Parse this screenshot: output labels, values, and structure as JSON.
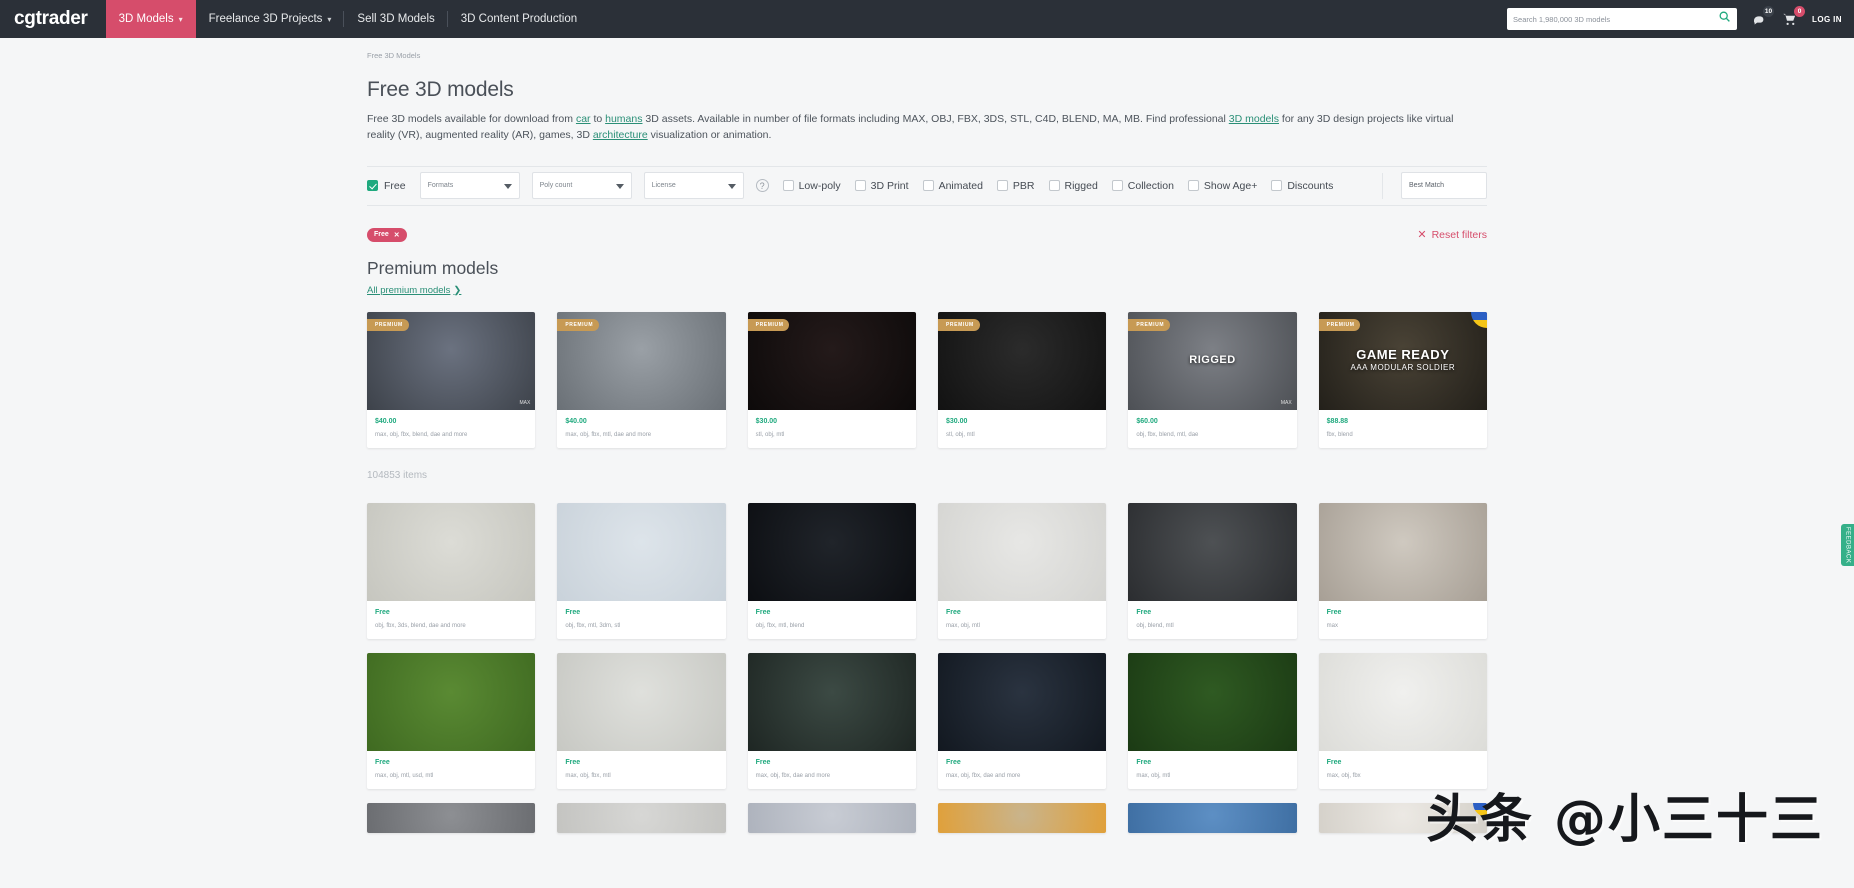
{
  "header": {
    "brand": "cgtrader",
    "nav": [
      {
        "label": "3D Models",
        "active": true,
        "caret": true
      },
      {
        "label": "Freelance 3D Projects",
        "active": false,
        "caret": true
      },
      {
        "label": "Sell 3D Models",
        "active": false,
        "caret": false
      },
      {
        "label": "3D Content Production",
        "active": false,
        "caret": false
      }
    ],
    "search_placeholder": "Search 1,980,000 3D models",
    "notifications_count": "10",
    "cart_count": "0",
    "login_label": "LOG IN"
  },
  "breadcrumb": "Free 3D Models",
  "page_title": "Free 3D models",
  "intro": {
    "p1a": "Free 3D models available for download from ",
    "link_car": "car",
    "p1b": " to ",
    "link_humans": "humans",
    "p1c": " 3D assets. Available in number of file formats including MAX, OBJ, FBX, 3DS, STL, C4D, BLEND, MA, MB. Find professional ",
    "link_models": "3D models",
    "p1d": " for any 3D design projects like virtual reality (VR), augmented reality (AR), games, 3D ",
    "link_arch": "architecture",
    "p1e": " visualization or animation."
  },
  "filters": {
    "free_label": "Free",
    "free_checked": true,
    "selects": [
      {
        "label": "Formats"
      },
      {
        "label": "Poly count"
      },
      {
        "label": "License"
      }
    ],
    "help_icon": "?",
    "checkboxes": [
      {
        "label": "Low-poly"
      },
      {
        "label": "3D Print"
      },
      {
        "label": "Animated"
      },
      {
        "label": "PBR"
      },
      {
        "label": "Rigged"
      },
      {
        "label": "Collection"
      },
      {
        "label": "Show Age+"
      },
      {
        "label": "Discounts"
      }
    ],
    "sort_label": "Best Match"
  },
  "active_tags": [
    {
      "label": "Free",
      "remove": "✕"
    }
  ],
  "reset_filters": {
    "icon": "✕",
    "label": "Reset filters"
  },
  "premium": {
    "heading": "Premium models",
    "all_link": "All premium models",
    "all_link_chevron": "❯",
    "badge": "PREMIUM",
    "cards": [
      {
        "price": "$40.00",
        "formats": "max, obj, fbx, blend, dae and more",
        "overlay": "",
        "sub": "",
        "bg1": "#6b7280",
        "bg2": "#3d424a",
        "flag": false,
        "corner": "MAX"
      },
      {
        "price": "$40.00",
        "formats": "max, obj, fbx, mtl, dae and more",
        "overlay": "",
        "sub": "",
        "bg1": "#9aa0a6",
        "bg2": "#6a7076",
        "flag": false,
        "corner": ""
      },
      {
        "price": "$30.00",
        "formats": "stl, obj, mtl",
        "overlay": "",
        "sub": "",
        "bg1": "#241a1a",
        "bg2": "#0d0a0a",
        "flag": false,
        "corner": ""
      },
      {
        "price": "$30.00",
        "formats": "stl, obj, mtl",
        "overlay": "",
        "sub": "",
        "bg1": "#2b2b2b",
        "bg2": "#121212",
        "flag": false,
        "corner": ""
      },
      {
        "price": "$60.00",
        "formats": "obj, fbx, blend, mtl, dae",
        "overlay": "RIGGED",
        "sub": "",
        "bg1": "#7d8086",
        "bg2": "#4d5055",
        "flag": false,
        "corner": "MAX"
      },
      {
        "price": "$88.88",
        "formats": "fbx, blend",
        "overlay": "GAME READY",
        "sub": "AAA MODULAR SOLDIER",
        "bg1": "#4a4336",
        "bg2": "#23201a",
        "flag": true,
        "corner": ""
      }
    ]
  },
  "results": {
    "count_label": "104853 items",
    "free_label": "Free",
    "rows": [
      [
        {
          "formats": "obj, fbx, 3ds, blend, dae and more",
          "bg1": "#dcdcd6",
          "bg2": "#c6c6bf"
        },
        {
          "formats": "obj, fbx, mtl, 3dm, stl",
          "bg1": "#dde4ea",
          "bg2": "#c9d2da"
        },
        {
          "formats": "obj, fbx, mtl, blend",
          "bg1": "#20242a",
          "bg2": "#0c0e12"
        },
        {
          "formats": "max, obj, mtl",
          "bg1": "#e7e7e5",
          "bg2": "#d4d4d1"
        },
        {
          "formats": "obj, blend, mtl",
          "bg1": "#4e5154",
          "bg2": "#2b2d30"
        },
        {
          "formats": "max",
          "bg1": "#cfc9c0",
          "bg2": "#a79f95"
        }
      ],
      [
        {
          "formats": "max, obj, mtl, usd, mtl",
          "bg1": "#5a8a33",
          "bg2": "#3f6a21"
        },
        {
          "formats": "max, obj, fbx, mtl",
          "bg1": "#dfe0dc",
          "bg2": "#c7c8c3"
        },
        {
          "formats": "max, obj, fbx, dae and more",
          "bg1": "#3c4a44",
          "bg2": "#1e2623"
        },
        {
          "formats": "max, obj, fbx, dae and more",
          "bg1": "#2a3340",
          "bg2": "#121820"
        },
        {
          "formats": "max, obj, mtl",
          "bg1": "#2f5a22",
          "bg2": "#1b3a14"
        },
        {
          "formats": "max, obj, fbx",
          "bg1": "#f0f0ee",
          "bg2": "#dcdcd8"
        }
      ],
      [
        {
          "formats": "",
          "bg1": "#8d8f93",
          "bg2": "#6b6d71"
        },
        {
          "formats": "",
          "bg1": "#d7d7d5",
          "bg2": "#c4c4c1"
        },
        {
          "formats": "",
          "bg1": "#c8ccd4",
          "bg2": "#aeb3bd"
        },
        {
          "formats": "",
          "bg1": "#c9b48c",
          "bg2": "#e0a03a"
        },
        {
          "formats": "",
          "bg1": "#5d8fc4",
          "bg2": "#3f6fa3"
        },
        {
          "formats": "",
          "bg1": "#ece9e4",
          "bg2": "#d5d1ca"
        }
      ]
    ]
  },
  "feedback_tab": "FEEDBACK",
  "watermark": "头条 @小三十三"
}
